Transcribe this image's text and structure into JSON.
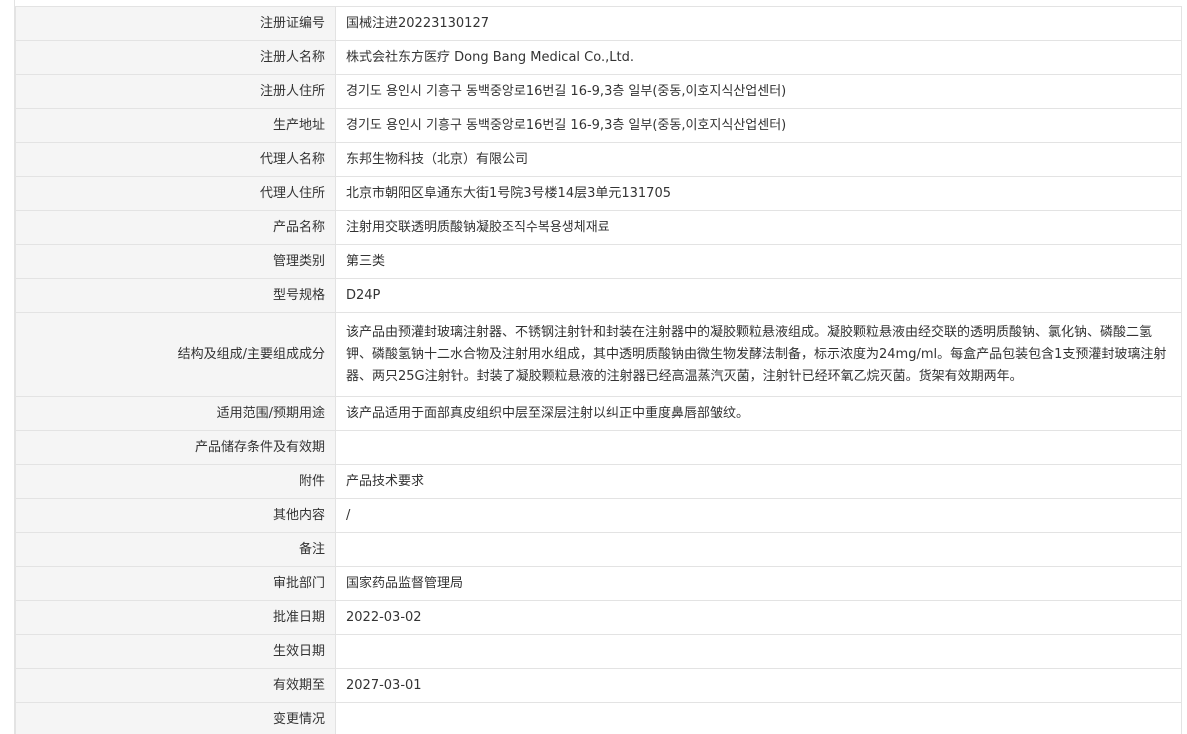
{
  "rows": [
    {
      "label": "注册证编号",
      "value": "国械注进20223130127"
    },
    {
      "label": "注册人名称",
      "value": "株式会社东方医疗 Dong Bang Medical Co.,Ltd."
    },
    {
      "label": "注册人住所",
      "value": "경기도 용인시 기흥구 동백중앙로16번길 16-9,3층 일부(중동,이호지식산업센터)"
    },
    {
      "label": "生产地址",
      "value": "경기도 용인시 기흥구 동백중앙로16번길 16-9,3층 일부(중동,이호지식산업센터)"
    },
    {
      "label": "代理人名称",
      "value": "东邦生物科技（北京）有限公司"
    },
    {
      "label": "代理人住所",
      "value": "北京市朝阳区阜通东大街1号院3号楼14层3单元131705"
    },
    {
      "label": "产品名称",
      "value": "注射用交联透明质酸钠凝胶조직수복용생체재료"
    },
    {
      "label": "管理类别",
      "value": "第三类"
    },
    {
      "label": "型号规格",
      "value": "D24P"
    },
    {
      "label": "结构及组成/主要组成成分",
      "value": "该产品由预灌封玻璃注射器、不锈钢注射针和封装在注射器中的凝胶颗粒悬液组成。凝胶颗粒悬液由经交联的透明质酸钠、氯化钠、磷酸二氢钾、磷酸氢钠十二水合物及注射用水组成，其中透明质酸钠由微生物发酵法制备，标示浓度为24mg/ml。每盒产品包装包含1支预灌封玻璃注射器、两只25G注射针。封装了凝胶颗粒悬液的注射器已经高温蒸汽灭菌，注射针已经环氧乙烷灭菌。货架有效期两年。"
    },
    {
      "label": "适用范围/预期用途",
      "value": "该产品适用于面部真皮组织中层至深层注射以纠正中重度鼻唇部皱纹。"
    },
    {
      "label": "产品储存条件及有效期",
      "value": ""
    },
    {
      "label": "附件",
      "value": "产品技术要求"
    },
    {
      "label": "其他内容",
      "value": "/"
    },
    {
      "label": "备注",
      "value": ""
    },
    {
      "label": "审批部门",
      "value": "国家药品监督管理局"
    },
    {
      "label": "批准日期",
      "value": "2022-03-02"
    },
    {
      "label": "生效日期",
      "value": ""
    },
    {
      "label": "有效期至",
      "value": "2027-03-01"
    },
    {
      "label": "变更情况",
      "value": ""
    }
  ]
}
